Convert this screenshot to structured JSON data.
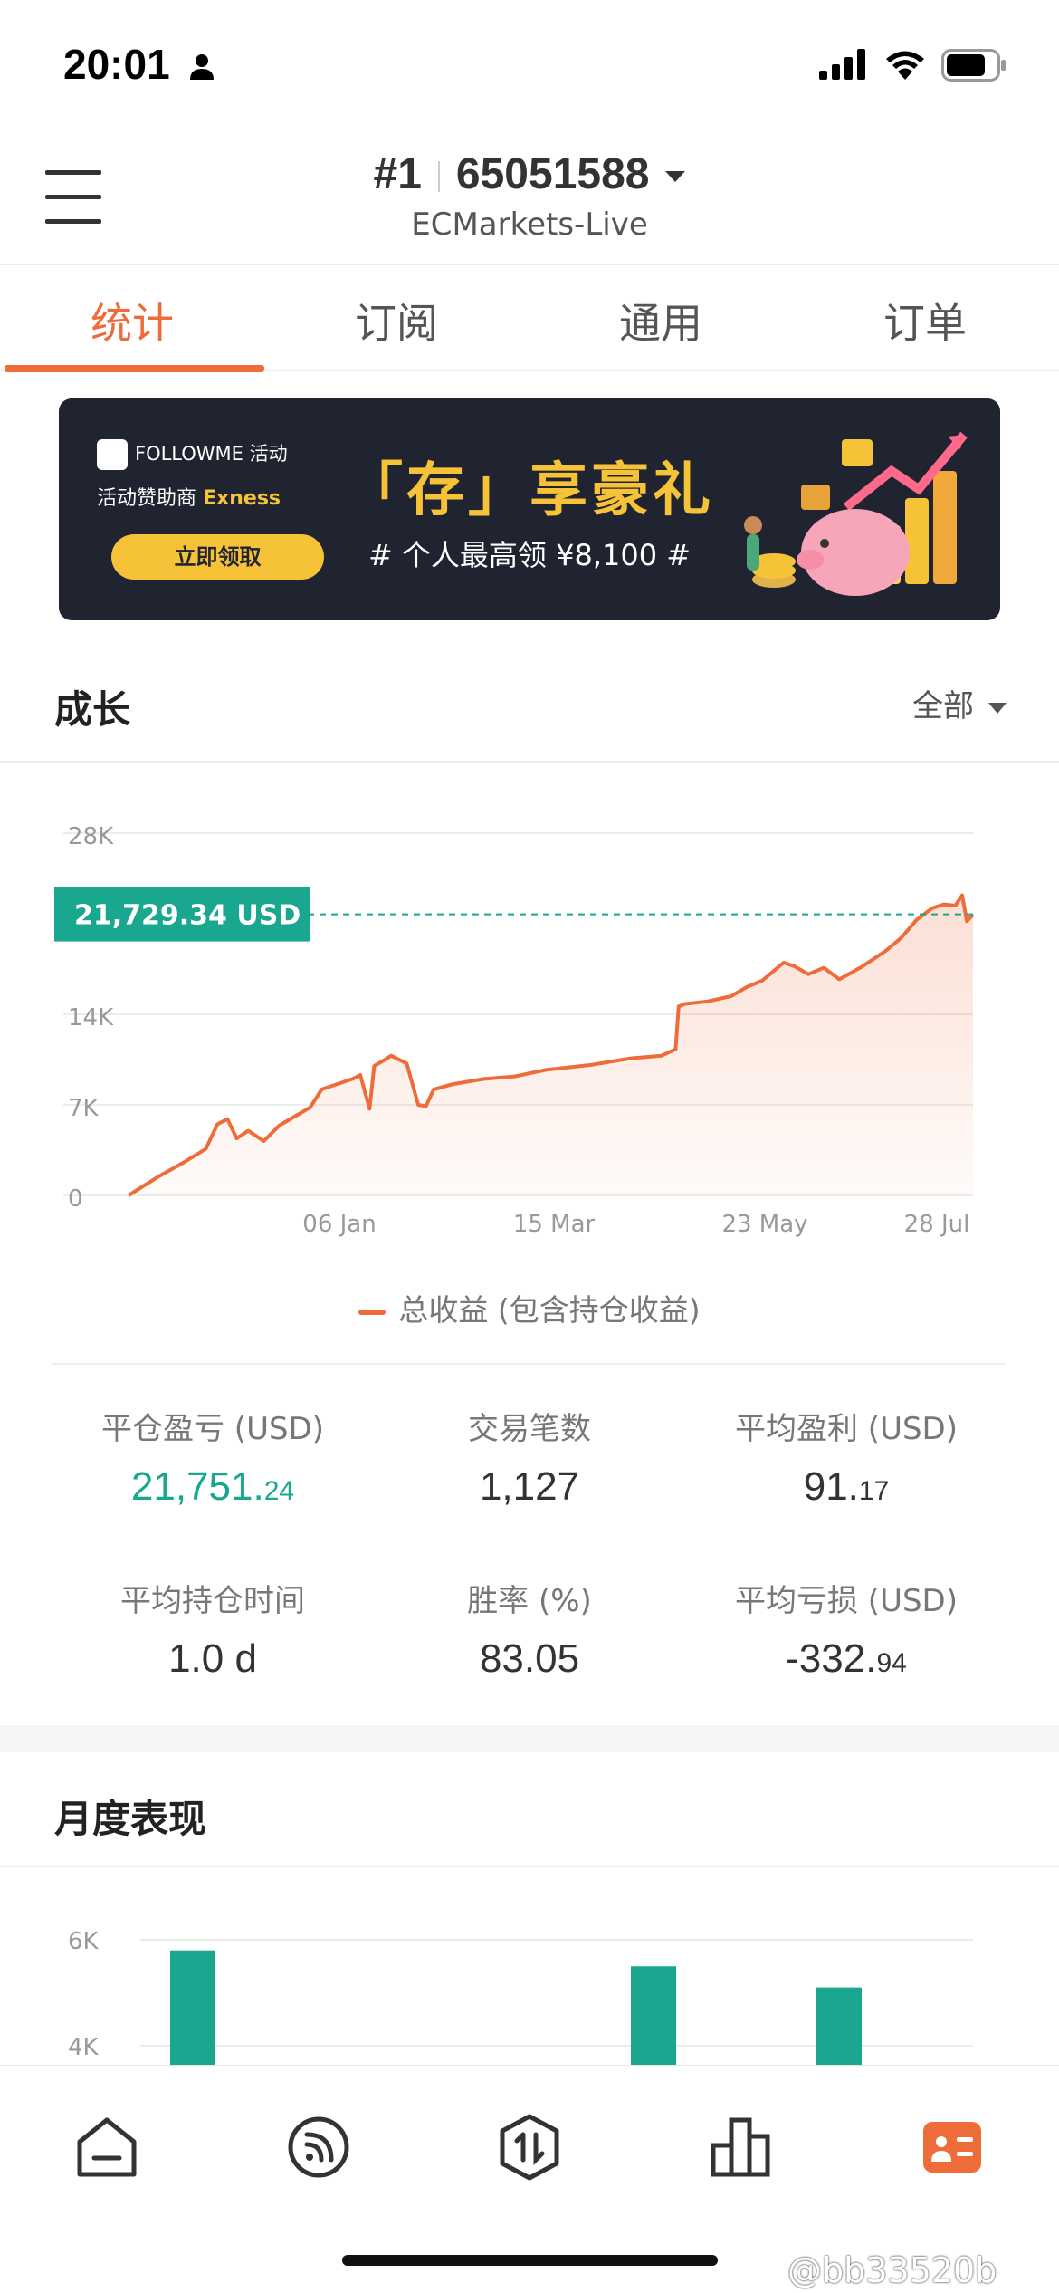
{
  "status_bar": {
    "time": "20:01"
  },
  "header": {
    "account_rank": "#1",
    "account_id": "65051588",
    "broker": "ECMarkets-Live"
  },
  "tabs": [
    {
      "label": "统计",
      "active": true
    },
    {
      "label": "订阅",
      "active": false
    },
    {
      "label": "通用",
      "active": false
    },
    {
      "label": "订单",
      "active": false
    }
  ],
  "banner": {
    "logo_text": "FOLLOWME 活动",
    "sponsor_prefix": "活动赞助商",
    "sponsor_name": "Exness",
    "button_label": "立即领取",
    "title": "「存」享豪礼",
    "subtitle": "# 个人最高领 ¥8,100 #"
  },
  "growth": {
    "title": "成长",
    "filter": "全部",
    "current_label": "21,729.34 USD",
    "legend": "总收益 (包含持仓收益)"
  },
  "stats": [
    {
      "label": "平仓盈亏 (USD)",
      "int": "21,751.",
      "dec": "24",
      "color": "#19a88f"
    },
    {
      "label": "交易笔数",
      "int": "1,127",
      "dec": "",
      "color": "#333333"
    },
    {
      "label": "平均盈利 (USD)",
      "int": "91.",
      "dec": "17",
      "color": "#333333"
    },
    {
      "label": "平均持仓时间",
      "int": "1.0 d",
      "dec": "",
      "color": "#333333"
    },
    {
      "label": "胜率 (%)",
      "int": "83.05",
      "dec": "",
      "color": "#333333"
    },
    {
      "label": "平均亏损 (USD)",
      "int": "-332.",
      "dec": "94",
      "color": "#333333"
    }
  ],
  "monthly": {
    "title": "月度表现"
  },
  "nav": [
    {
      "icon": "home-icon",
      "active": false
    },
    {
      "icon": "feed-icon",
      "active": false
    },
    {
      "icon": "trade-icon",
      "active": false
    },
    {
      "icon": "ranking-icon",
      "active": false
    },
    {
      "icon": "profile-card-icon",
      "active": true
    }
  ],
  "watermark": "@bb33520b",
  "colors": {
    "accent": "#ee6c3a",
    "positive": "#19a88f",
    "bar": "#19a88f"
  },
  "chart_data": [
    {
      "type": "area",
      "title": "",
      "y_ticks": [
        "28K",
        "14K",
        "7K",
        "0"
      ],
      "x_ticks": [
        "06 Jan",
        "15 Mar",
        "23 May",
        "28 Jul"
      ],
      "ylim": [
        0,
        28000
      ],
      "grid": true,
      "legend_position": "bottom",
      "marker_value": 21729.34,
      "series": [
        {
          "name": "总收益 (包含持仓收益)",
          "color": "#ee6c3a",
          "points": [
            [
              0,
              0
            ],
            [
              40,
              1500
            ],
            [
              70,
              2500
            ],
            [
              100,
              3600
            ],
            [
              115,
              5500
            ],
            [
              128,
              5900
            ],
            [
              140,
              4400
            ],
            [
              155,
              5000
            ],
            [
              175,
              4200
            ],
            [
              195,
              5400
            ],
            [
              235,
              6800
            ],
            [
              250,
              8200
            ],
            [
              290,
              9000
            ],
            [
              300,
              9300
            ],
            [
              312,
              6700
            ],
            [
              318,
              10000
            ],
            [
              332,
              10500
            ],
            [
              340,
              10800
            ],
            [
              360,
              10200
            ],
            [
              375,
              7000
            ],
            [
              385,
              6900
            ],
            [
              395,
              8200
            ],
            [
              420,
              8600
            ],
            [
              460,
              9000
            ],
            [
              500,
              9200
            ],
            [
              540,
              9700
            ],
            [
              600,
              10100
            ],
            [
              650,
              10600
            ],
            [
              690,
              10800
            ],
            [
              708,
              11300
            ],
            [
              712,
              14600
            ],
            [
              720,
              14800
            ],
            [
              750,
              15000
            ],
            [
              780,
              15400
            ],
            [
              800,
              16100
            ],
            [
              820,
              16600
            ],
            [
              848,
              18000
            ],
            [
              862,
              17700
            ],
            [
              880,
              17100
            ],
            [
              900,
              17600
            ],
            [
              920,
              16700
            ],
            [
              950,
              17700
            ],
            [
              980,
              18900
            ],
            [
              1000,
              19900
            ],
            [
              1020,
              21300
            ],
            [
              1040,
              22200
            ],
            [
              1055,
              22500
            ],
            [
              1070,
              22400
            ],
            [
              1079,
              23200
            ],
            [
              1085,
              21200
            ],
            [
              1093,
              21700
            ]
          ]
        }
      ]
    },
    {
      "type": "bar",
      "title": "",
      "y_ticks": [
        "6K",
        "4K"
      ],
      "series": [
        {
          "name": "",
          "color": "#19a88f",
          "values": [
            5800,
            5500,
            5100
          ]
        }
      ]
    }
  ]
}
